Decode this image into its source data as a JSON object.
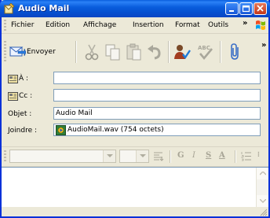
{
  "window": {
    "title": "Audio Mail"
  },
  "menubar": {
    "items": [
      {
        "label": "Fichier"
      },
      {
        "label": "Edition"
      },
      {
        "label": "Affichage"
      },
      {
        "label": "Insertion"
      },
      {
        "label": "Format"
      },
      {
        "label": "Outils"
      }
    ],
    "overflow": "»"
  },
  "toolbar": {
    "send_label": "Envoyer",
    "overflow": "»",
    "icons": [
      "send-icon",
      "cut-icon",
      "copy-icon",
      "paste-icon",
      "undo-icon",
      "check-names-icon",
      "spelling-icon",
      "attach-icon"
    ]
  },
  "address": {
    "to_label": "À :",
    "to_value": "",
    "cc_label": "Cc :",
    "cc_value": "",
    "subject_label": "Objet :",
    "subject_value": "Audio Mail",
    "attach_label": "Joindre :",
    "attachment": "AudioMail.wav (754 octets)"
  },
  "formatting": {
    "font_name": "",
    "font_size": "",
    "icons": [
      "paragraph-style-icon",
      "bold-icon",
      "italic-icon",
      "underline-icon",
      "font-color-icon",
      "numbered-list-icon"
    ]
  },
  "editor": {
    "body": ""
  },
  "colors": {
    "titlebar": "#0a5ede",
    "window_bg": "#ece9d8",
    "field_border": "#7f9db9"
  }
}
